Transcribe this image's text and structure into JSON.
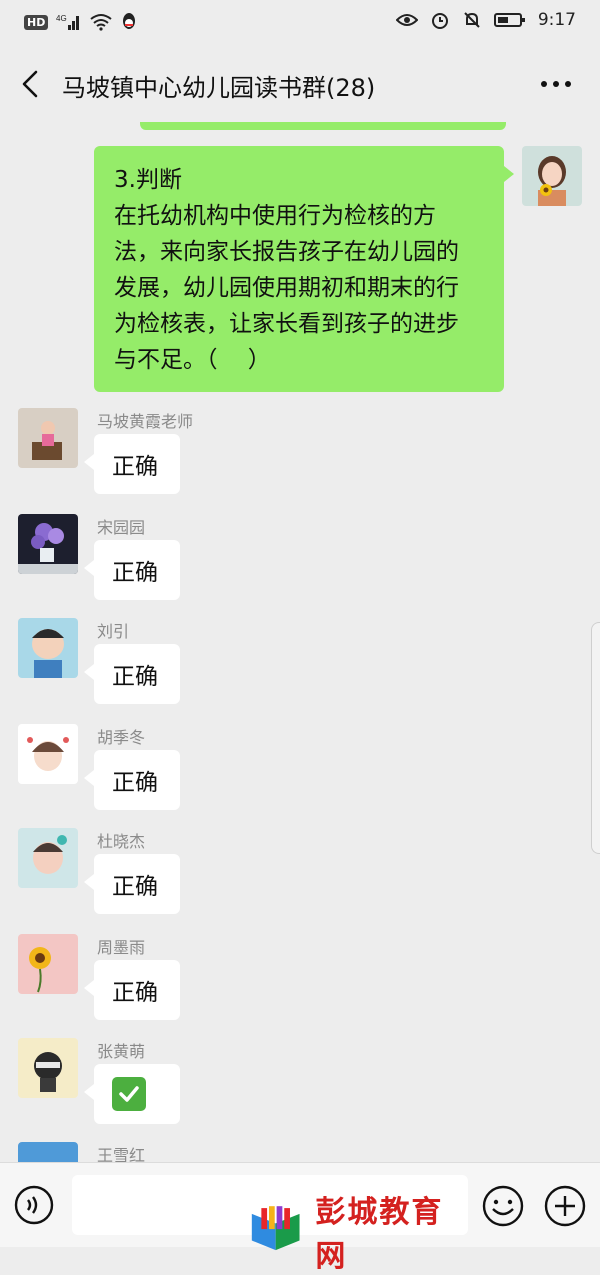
{
  "status_bar": {
    "hd": "HD",
    "signal_label": "4G",
    "time": "9:17",
    "icons": [
      "hd-icon",
      "signal-icon",
      "wifi-icon",
      "qq-icon",
      "eye-icon",
      "alarm-icon",
      "mute-bell-icon",
      "battery-icon"
    ]
  },
  "header": {
    "title": "马坡镇中心幼儿园读书群(28)",
    "back_icon": "chevron-left-icon",
    "more_icon": "more-dots-icon"
  },
  "self_message": {
    "lines": [
      "3.判断",
      "在托幼机构中使用行为检核的方",
      "法，来向家长报告孩子在幼儿园的",
      "发展，幼儿园使用期初和期末的行",
      "为检核表，让家长看到孩子的进步",
      "与不足。（　 ）"
    ]
  },
  "messages": [
    {
      "sender": "马坡黄霞老师",
      "text": "正确"
    },
    {
      "sender": "宋园园",
      "text": "正确"
    },
    {
      "sender": "刘引",
      "text": "正确"
    },
    {
      "sender": "胡季冬",
      "text": "正确"
    },
    {
      "sender": "杜晓杰",
      "text": "正确"
    },
    {
      "sender": "周墨雨",
      "text": "正确"
    },
    {
      "sender": "张黄萌",
      "text": "",
      "emoji": "check-mark-button-icon"
    },
    {
      "sender": "王雪红",
      "text": ""
    }
  ],
  "bottom_bar": {
    "watermark": "彭城教育网",
    "icons": [
      "voice-icon",
      "emoji-icon",
      "plus-icon"
    ]
  },
  "colors": {
    "background": "#ededed",
    "self_bubble": "#95ec69",
    "other_bubble": "#ffffff",
    "watermark": "#d4211f"
  }
}
